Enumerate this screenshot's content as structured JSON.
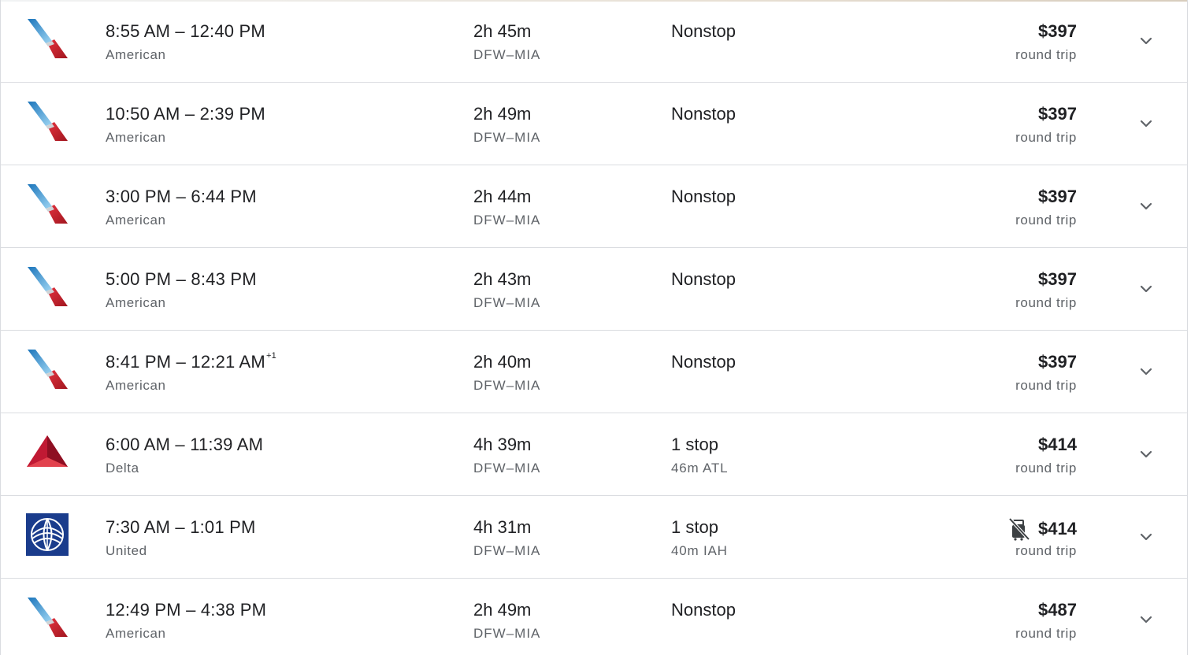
{
  "flights": [
    {
      "logo": "american-airlines-logo",
      "depart": "8:55 AM",
      "arrive": "12:40 PM",
      "next_day": "",
      "airline": "American",
      "duration": "2h 45m",
      "route": "DFW–MIA",
      "stops": "Nonstop",
      "layover": "",
      "price": "$397",
      "trip": "round trip",
      "no_carry_on": false
    },
    {
      "logo": "american-airlines-logo",
      "depart": "10:50 AM",
      "arrive": "2:39 PM",
      "next_day": "",
      "airline": "American",
      "duration": "2h 49m",
      "route": "DFW–MIA",
      "stops": "Nonstop",
      "layover": "",
      "price": "$397",
      "trip": "round trip",
      "no_carry_on": false
    },
    {
      "logo": "american-airlines-logo",
      "depart": "3:00 PM",
      "arrive": "6:44 PM",
      "next_day": "",
      "airline": "American",
      "duration": "2h 44m",
      "route": "DFW–MIA",
      "stops": "Nonstop",
      "layover": "",
      "price": "$397",
      "trip": "round trip",
      "no_carry_on": false
    },
    {
      "logo": "american-airlines-logo",
      "depart": "5:00 PM",
      "arrive": "8:43 PM",
      "next_day": "",
      "airline": "American",
      "duration": "2h 43m",
      "route": "DFW–MIA",
      "stops": "Nonstop",
      "layover": "",
      "price": "$397",
      "trip": "round trip",
      "no_carry_on": false
    },
    {
      "logo": "american-airlines-logo",
      "depart": "8:41 PM",
      "arrive": "12:21 AM",
      "next_day": "+1",
      "airline": "American",
      "duration": "2h 40m",
      "route": "DFW–MIA",
      "stops": "Nonstop",
      "layover": "",
      "price": "$397",
      "trip": "round trip",
      "no_carry_on": false
    },
    {
      "logo": "delta-logo",
      "depart": "6:00 AM",
      "arrive": "11:39 AM",
      "next_day": "",
      "airline": "Delta",
      "duration": "4h 39m",
      "route": "DFW–MIA",
      "stops": "1 stop",
      "layover": "46m ATL",
      "price": "$414",
      "trip": "round trip",
      "no_carry_on": false
    },
    {
      "logo": "united-logo",
      "depart": "7:30 AM",
      "arrive": "1:01 PM",
      "next_day": "",
      "airline": "United",
      "duration": "4h 31m",
      "route": "DFW–MIA",
      "stops": "1 stop",
      "layover": "40m IAH",
      "price": "$414",
      "trip": "round trip",
      "no_carry_on": true
    },
    {
      "logo": "american-airlines-logo",
      "depart": "12:49 PM",
      "arrive": "4:38 PM",
      "next_day": "",
      "airline": "American",
      "duration": "2h 49m",
      "route": "DFW–MIA",
      "stops": "Nonstop",
      "layover": "",
      "price": "$487",
      "trip": "round trip",
      "no_carry_on": false
    }
  ],
  "time_separator": " – ",
  "icons": {
    "expand": "chevron-down-icon",
    "no_carry_on": "no-carry-on-bag-icon"
  },
  "colors": {
    "text_primary": "#202124",
    "text_secondary": "#5f6368",
    "divider": "#dadce0",
    "american_blue": "#36a3e0",
    "american_red": "#c8202f",
    "delta_red": "#c01933",
    "united_blue": "#1a3c8c"
  }
}
